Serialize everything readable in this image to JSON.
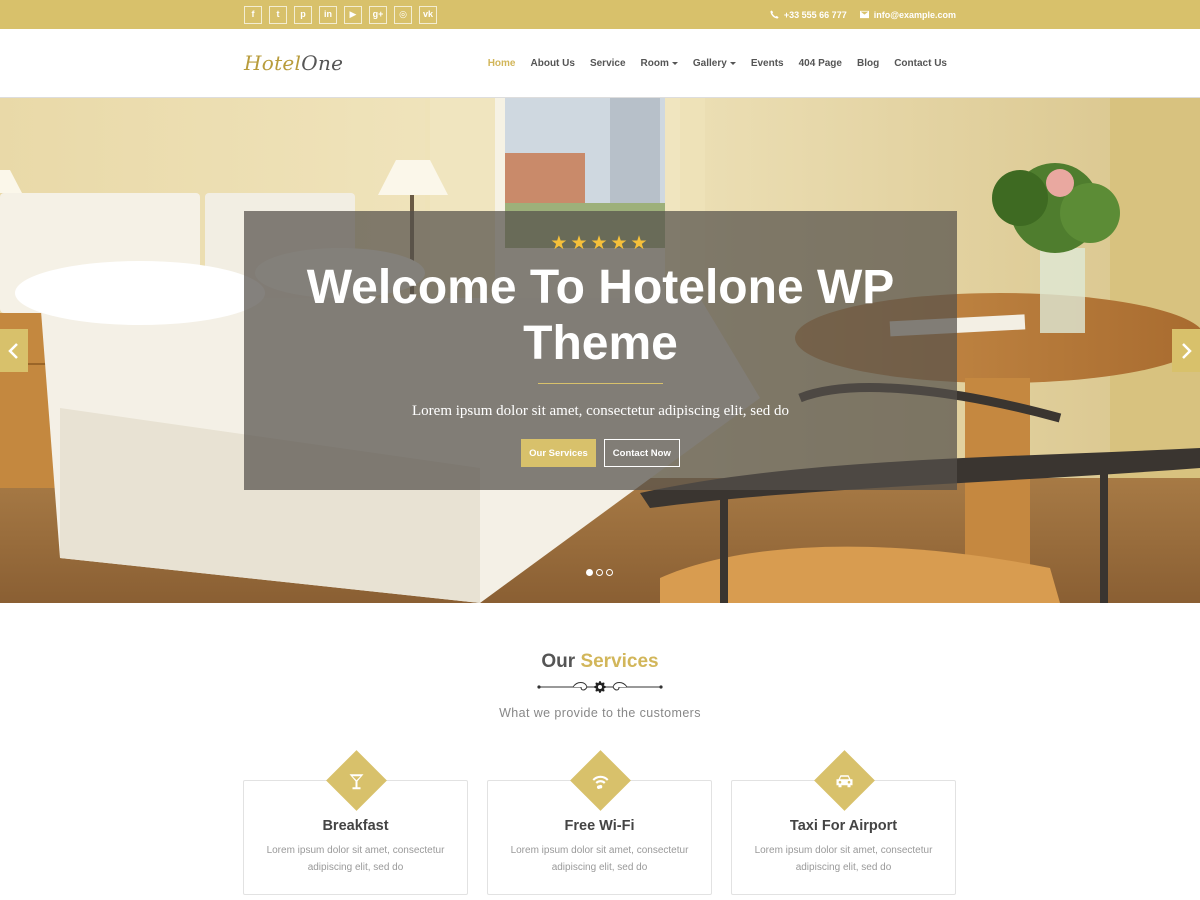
{
  "colors": {
    "accent": "#d8c16b",
    "accent_text": "#d2b65a",
    "text": "#555555"
  },
  "topbar": {
    "socials": [
      {
        "icon": "facebook-icon",
        "glyph": "f"
      },
      {
        "icon": "twitter-icon",
        "glyph": "t"
      },
      {
        "icon": "pinterest-icon",
        "glyph": "p"
      },
      {
        "icon": "linkedin-icon",
        "glyph": "in"
      },
      {
        "icon": "youtube-icon",
        "glyph": "▶"
      },
      {
        "icon": "google-plus-icon",
        "glyph": "g+"
      },
      {
        "icon": "instagram-icon",
        "glyph": "◎"
      },
      {
        "icon": "vk-icon",
        "glyph": "vk"
      }
    ],
    "phone": "+33 555 66 777",
    "email": "info@example.com"
  },
  "header": {
    "logo_part1": "Hotel",
    "logo_part2": "One",
    "nav": [
      {
        "label": "Home",
        "active": true
      },
      {
        "label": "About Us"
      },
      {
        "label": "Service"
      },
      {
        "label": "Room",
        "dropdown": true
      },
      {
        "label": "Gallery",
        "dropdown": true
      },
      {
        "label": "Events"
      },
      {
        "label": "404 Page"
      },
      {
        "label": "Blog"
      },
      {
        "label": "Contact Us"
      }
    ]
  },
  "hero": {
    "stars": "★★★★★",
    "rating": 5,
    "title_line1": "Welcome To Hotelone WP",
    "title_line2": "Theme",
    "subtitle": "Lorem ipsum dolor sit amet, consectetur adipiscing elit, sed do",
    "primary_button": "Our Services",
    "secondary_button": "Contact Now",
    "slide_count": 3,
    "active_slide": 1
  },
  "services": {
    "title_part1": "Our",
    "title_part2": "Services",
    "subtitle": "What we provide to the customers",
    "cards": [
      {
        "icon": "cocktail-icon",
        "title": "Breakfast",
        "text": "Lorem ipsum dolor sit amet, consectetur adipiscing elit, sed do"
      },
      {
        "icon": "wifi-icon",
        "title": "Free Wi-Fi",
        "text": "Lorem ipsum dolor sit amet, consectetur adipiscing elit, sed do"
      },
      {
        "icon": "car-icon",
        "title": "Taxi For Airport",
        "text": "Lorem ipsum dolor sit amet, consectetur adipiscing elit, sed do"
      }
    ]
  }
}
